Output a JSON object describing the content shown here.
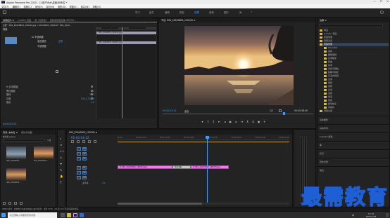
{
  "window": {
    "title": "Adobe Premiere Pro 2020 - C:\\用户\\Kai\\桌面\\未命名 *",
    "app_icon": "Pr",
    "minimize": "—",
    "maximize": "☐",
    "close": "✕"
  },
  "menu": [
    "文件(F)",
    "编辑(E)",
    "剪辑(C)",
    "序列(S)",
    "标记(M)",
    "图形(G)",
    "视图(V)",
    "窗口(W)",
    "帮助(H)"
  ],
  "workspaces": {
    "items": [
      "学习",
      "组件",
      "编辑",
      "颜色",
      "效果",
      "音频",
      "图形",
      "库"
    ],
    "active_index": 4,
    "more": "»"
  },
  "effect_controls": {
    "tabs": [
      "效果控件 ≡",
      "Lumetri 范围",
      "源: (无剪辑)",
      "音频剪辑混合器: DSC00..."
    ],
    "source_line": "主要 * IMG_20200803_190249.jpg ∨ DSC00803_190249 * IMG_2020...",
    "clip_name": "IMG_20200803_...",
    "opacity_label": "不透明度",
    "fx_label": "fx 不透明度",
    "blend_label": "混合模式",
    "blend_value": "正常",
    "video_label": "视频",
    "rows": [
      {
        "label": "fx 比例模板",
        "value": ""
      },
      {
        "label": "  等比缩放",
        "value": "✓"
      },
      {
        "label": "  旋转",
        "value": "0.0°"
      },
      {
        "label": "  位置",
        "value": "100.0   100.0"
      },
      {
        "label": "  锚点",
        "value": "0.0"
      }
    ],
    "timecode": "00:00:03:22",
    "mini_clips": [
      "IMG_20200803_190249.jpg",
      "IMG_20200803_190255.jpg"
    ],
    "mini_ruler": [
      "00:00",
      "00:00:04:00",
      "00:00:08:00"
    ]
  },
  "program_monitor": {
    "title": "节目: IMG_20200803_190249 ≡",
    "timecode_left": "00:00:04:22",
    "fit_label": "适合",
    "quality_label": "1/2",
    "timecode_right": "00:00:08:00",
    "settings_icon": "wrench-icon"
  },
  "effects_panel": {
    "title": "效果 ≡",
    "search_placeholder": "",
    "items": [
      {
        "label": "预设",
        "level": 0
      },
      {
        "label": "Lumetri 预设",
        "level": 0
      },
      {
        "label": "音频效果",
        "level": 0
      },
      {
        "label": "音频过渡",
        "level": 0
      },
      {
        "label": "视频效果",
        "level": 0
      },
      {
        "label": "Obsolete",
        "level": 1
      },
      {
        "label": "变换",
        "level": 1
      },
      {
        "label": "图像控制",
        "level": 1
      },
      {
        "label": "实用程序",
        "level": 1
      },
      {
        "label": "扭曲",
        "level": 1
      },
      {
        "label": "时间",
        "level": 1
      },
      {
        "label": "杂色与颗粒",
        "level": 1
      },
      {
        "label": "模糊与锐化",
        "level": 1
      },
      {
        "label": "沉浸式视频",
        "level": 1
      },
      {
        "label": "生成",
        "level": 1
      },
      {
        "label": "视频",
        "level": 1
      },
      {
        "label": "调整",
        "level": 1
      },
      {
        "label": "过渡",
        "level": 1
      },
      {
        "label": "透视",
        "level": 1
      },
      {
        "label": "通道",
        "level": 1
      },
      {
        "label": "键控",
        "level": 1
      },
      {
        "label": "颜色校正",
        "level": 1
      },
      {
        "label": "风格化",
        "level": 1
      },
      {
        "label": "视频过渡",
        "level": 0
      }
    ],
    "selected_index": 4,
    "sections": [
      "基本图形",
      "基本声音",
      "Lumetri 颜色",
      "库",
      "标记",
      "历史记录",
      "信息"
    ]
  },
  "project_panel": {
    "tabs": [
      "项目: 未命名 ≡",
      "媒体浏览器"
    ],
    "project_file": "未命名.prproj",
    "item_count": "3 项",
    "search_placeholder": "",
    "items": [
      {
        "name": "IMG_20200803...",
        "duration": "5:00"
      },
      {
        "name": "IMG_20200803...",
        "duration": "5:00"
      },
      {
        "name": "IMG_20200803...",
        "duration": "5:00"
      }
    ]
  },
  "timeline": {
    "tab": "IMG_20200803_190249 ≡",
    "timecode": "00:00:04:22",
    "ruler": [
      "00:00",
      "00:00:05:00",
      "00:00:10:00",
      "00:00:15:00",
      "00:00:20:00",
      "00:00:25:00",
      "00:00:30:00",
      "00:00:35:00"
    ],
    "video_tracks": [
      "V3",
      "V2",
      "V1"
    ],
    "audio_tracks": [
      "A1",
      "A2",
      "A3"
    ],
    "master_label": "主声道",
    "master_value": "0.0",
    "clips": [
      {
        "label": "fx IMG_20200803_190249.jpg"
      },
      {
        "label": "fx IMG_20200803_190255.jpg"
      }
    ],
    "transition_label": "交叉溶解"
  },
  "status": "单击以选择，或单击空白处并拖拽以进行框选。使用 Shift、Alt 和 Ctrl 可获得其他选项。",
  "taskbar": {
    "search_placeholder": "在这里输入你要搜索的内容",
    "clock_time": "17:12",
    "clock_date": "2021/7/24",
    "lang": "中"
  },
  "watermark": "最需教育",
  "colors": {
    "accent": "#3f9cff",
    "clip_pink": "#d98cd6",
    "playhead": "#3f9cff",
    "watermark_fill": "#ffffff",
    "watermark_stroke": "#1f5fd6"
  }
}
